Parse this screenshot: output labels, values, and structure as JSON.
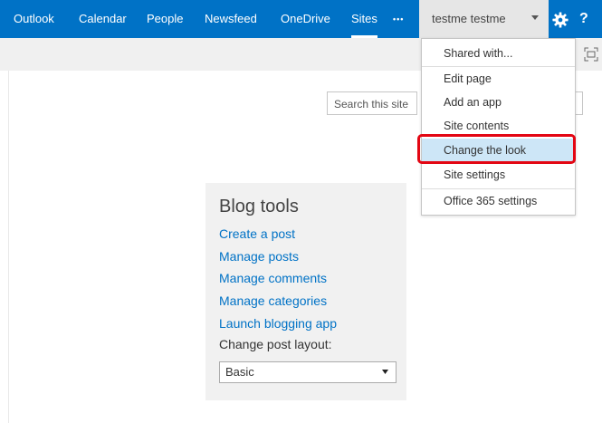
{
  "nav": {
    "links": [
      "Outlook",
      "Calendar",
      "People",
      "Newsfeed",
      "OneDrive",
      "Sites"
    ],
    "more": "•••",
    "user": "testme testme",
    "help": "?"
  },
  "search": {
    "placeholder": "Search this site"
  },
  "menu": {
    "items": [
      "Shared with...",
      "Edit page",
      "Add an app",
      "Site contents",
      "Change the look",
      "Site settings",
      "Office 365 settings"
    ],
    "highlighted": "Change the look",
    "highlight_color": "#cde6f7",
    "callout_color": "#e30613"
  },
  "blog": {
    "title": "Blog tools",
    "links": [
      "Create a post",
      "Manage posts",
      "Manage comments",
      "Manage categories",
      "Launch blogging app"
    ],
    "layout_label": "Change post layout:",
    "layout_value": "Basic"
  },
  "colors": {
    "suitebar": "#0072c6",
    "link": "#0072c6"
  }
}
